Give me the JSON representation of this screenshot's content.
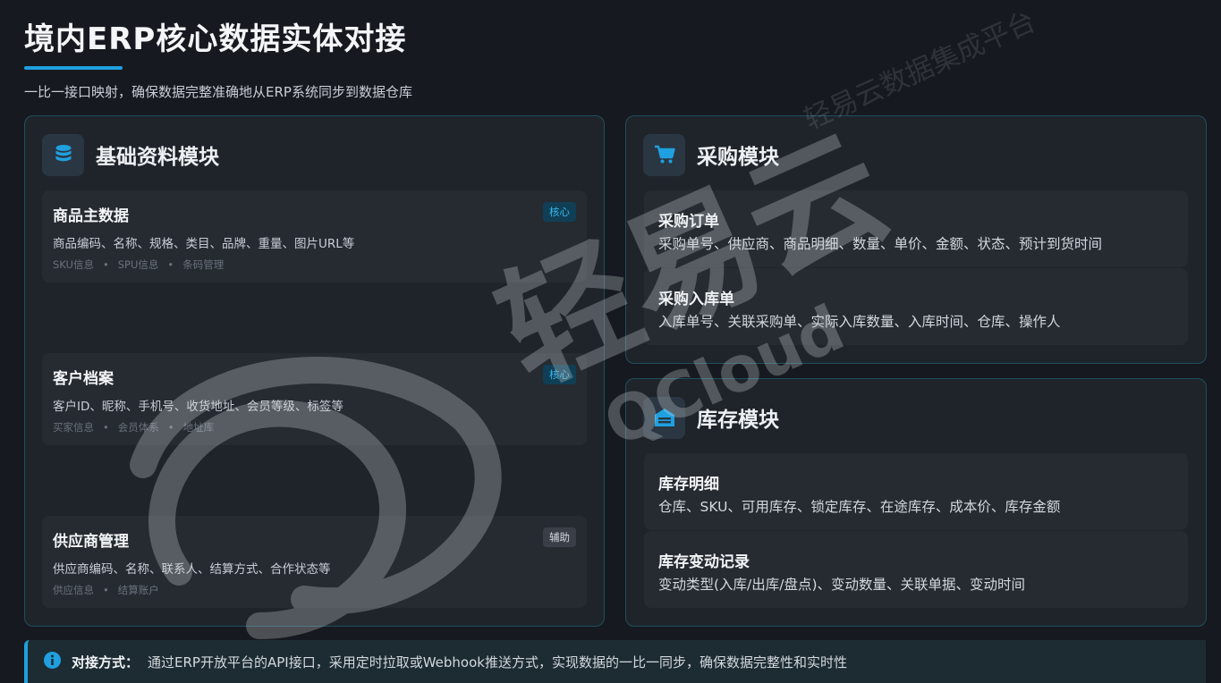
{
  "header": {
    "title": "境内ERP核心数据实体对接",
    "subtitle": "一比一接口映射，确保数据完整准确地从ERP系统同步到数据仓库"
  },
  "basic_module": {
    "title": "基础资料模块",
    "icon": "database-icon",
    "cards": [
      {
        "title": "商品主数据",
        "badge": "核心",
        "desc": "商品编码、名称、规格、类目、品牌、重量、图片URL等",
        "tags": [
          "SKU信息",
          "SPU信息",
          "条码管理"
        ]
      },
      {
        "title": "客户档案",
        "badge": "核心",
        "desc": "客户ID、昵称、手机号、收货地址、会员等级、标签等",
        "tags": [
          "买家信息",
          "会员体系",
          "地址库"
        ]
      },
      {
        "title": "供应商管理",
        "badge": "辅助",
        "desc": "供应商编码、名称、联系人、结算方式、合作状态等",
        "tags": [
          "供应信息",
          "结算账户"
        ]
      }
    ]
  },
  "purchase_module": {
    "title": "采购模块",
    "icon": "cart-icon",
    "cards": [
      {
        "title": "采购订单",
        "desc": "采购单号、供应商、商品明细、数量、单价、金额、状态、预计到货时间"
      },
      {
        "title": "采购入库单",
        "desc": "入库单号、关联采购单、实际入库数量、入库时间、仓库、操作人"
      }
    ]
  },
  "inventory_module": {
    "title": "库存模块",
    "icon": "warehouse-icon",
    "cards": [
      {
        "title": "库存明细",
        "desc": "仓库、SKU、可用库存、锁定库存、在途库存、成本价、库存金额"
      },
      {
        "title": "库存变动记录",
        "desc": "变动类型(入库/出库/盘点)、变动数量、关联单据、变动时间"
      }
    ]
  },
  "footer": {
    "label": "对接方式：",
    "text": "通过ERP开放平台的API接口，采用定时拉取或Webhook推送方式，实现数据的一比一同步，确保数据完整性和实时性",
    "icon": "info-icon"
  },
  "watermark": {
    "brand": "轻易云",
    "brand_en": "QCloud",
    "corner": "轻易云数据集成平台"
  },
  "colors": {
    "accent": "#1fa0e0",
    "background": "#16191f",
    "panel": "#1f242b",
    "border": "#1f4f5c"
  }
}
